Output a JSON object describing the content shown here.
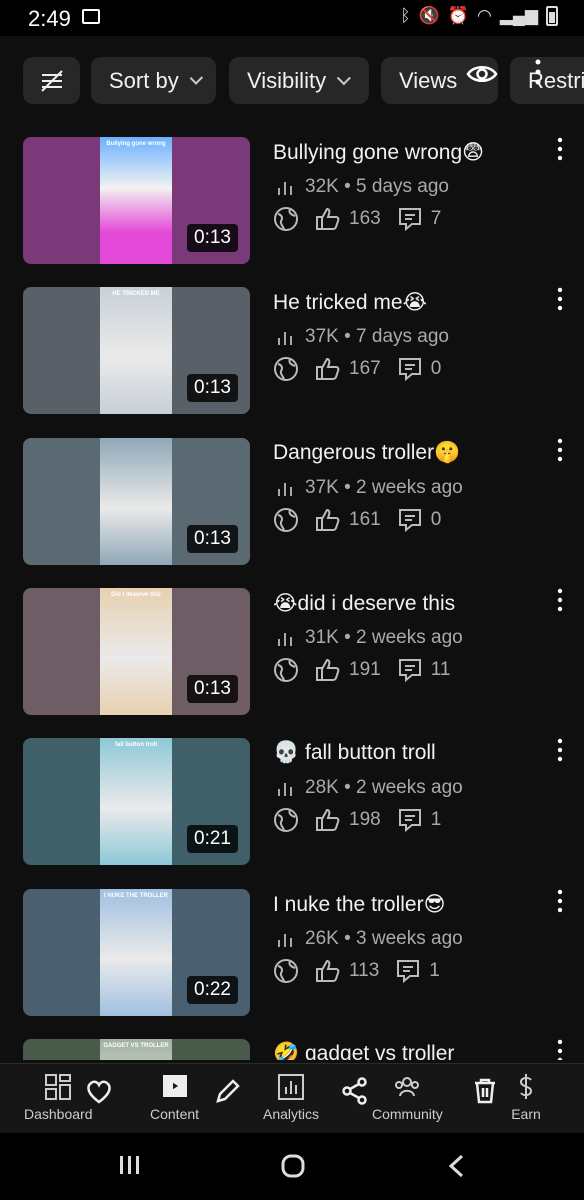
{
  "status_bar": {
    "time": "2:49"
  },
  "filters": {
    "sort_label": "Sort by",
    "visibility_label": "Visibility",
    "views_label": "Views",
    "restrictions_label": "Restric"
  },
  "videos": [
    {
      "title": "Bullying gone wrong😨",
      "views": "32K",
      "age": "5 days ago",
      "likes": "163",
      "comments": "7",
      "duration": "0:13",
      "thumb_caption": "Bullying gone wrong",
      "thumb_bg": "#7a3a7a",
      "thumb_fg": "#e34ad8"
    },
    {
      "title": "He tricked me😭",
      "views": "37K",
      "age": "7 days ago",
      "likes": "167",
      "comments": "0",
      "duration": "0:13",
      "thumb_caption": "HE TRICKED ME",
      "thumb_bg": "#5a6068",
      "thumb_fg": "#c8d0d8"
    },
    {
      "title": "Dangerous troller🤫",
      "views": "37K",
      "age": "2 weeks ago",
      "likes": "161",
      "comments": "0",
      "duration": "0:13",
      "thumb_caption": "",
      "thumb_bg": "#5b6a72",
      "thumb_fg": "#8fa8b8"
    },
    {
      "title": "😭did i deserve this",
      "views": "31K",
      "age": "2 weeks ago",
      "likes": "191",
      "comments": "11",
      "duration": "0:13",
      "thumb_caption": "Did I deserve this",
      "thumb_bg": "#6e5d64",
      "thumb_fg": "#e8d0b0"
    },
    {
      "title": "💀 fall button troll",
      "views": "28K",
      "age": "2 weeks ago",
      "likes": "198",
      "comments": "1",
      "duration": "0:21",
      "thumb_caption": "fall button troll",
      "thumb_bg": "#3f6068",
      "thumb_fg": "#8ec8d8"
    },
    {
      "title": "I nuke the troller😎",
      "views": "26K",
      "age": "3 weeks ago",
      "likes": "113",
      "comments": "1",
      "duration": "0:22",
      "thumb_caption": "I NUKE THE TROLLER",
      "thumb_bg": "#4a6070",
      "thumb_fg": "#a0c0e0"
    },
    {
      "title": "🤣 gadget vs troller",
      "views": "",
      "age": "",
      "likes": "",
      "comments": "",
      "duration": "",
      "thumb_caption": "GADGET VS TROLLER",
      "thumb_bg": "#4a5a4a",
      "thumb_fg": "#a0b0a0"
    }
  ],
  "nav": {
    "dashboard": "Dashboard",
    "content": "Content",
    "analytics": "Analytics",
    "community": "Community",
    "earn": "Earn"
  }
}
